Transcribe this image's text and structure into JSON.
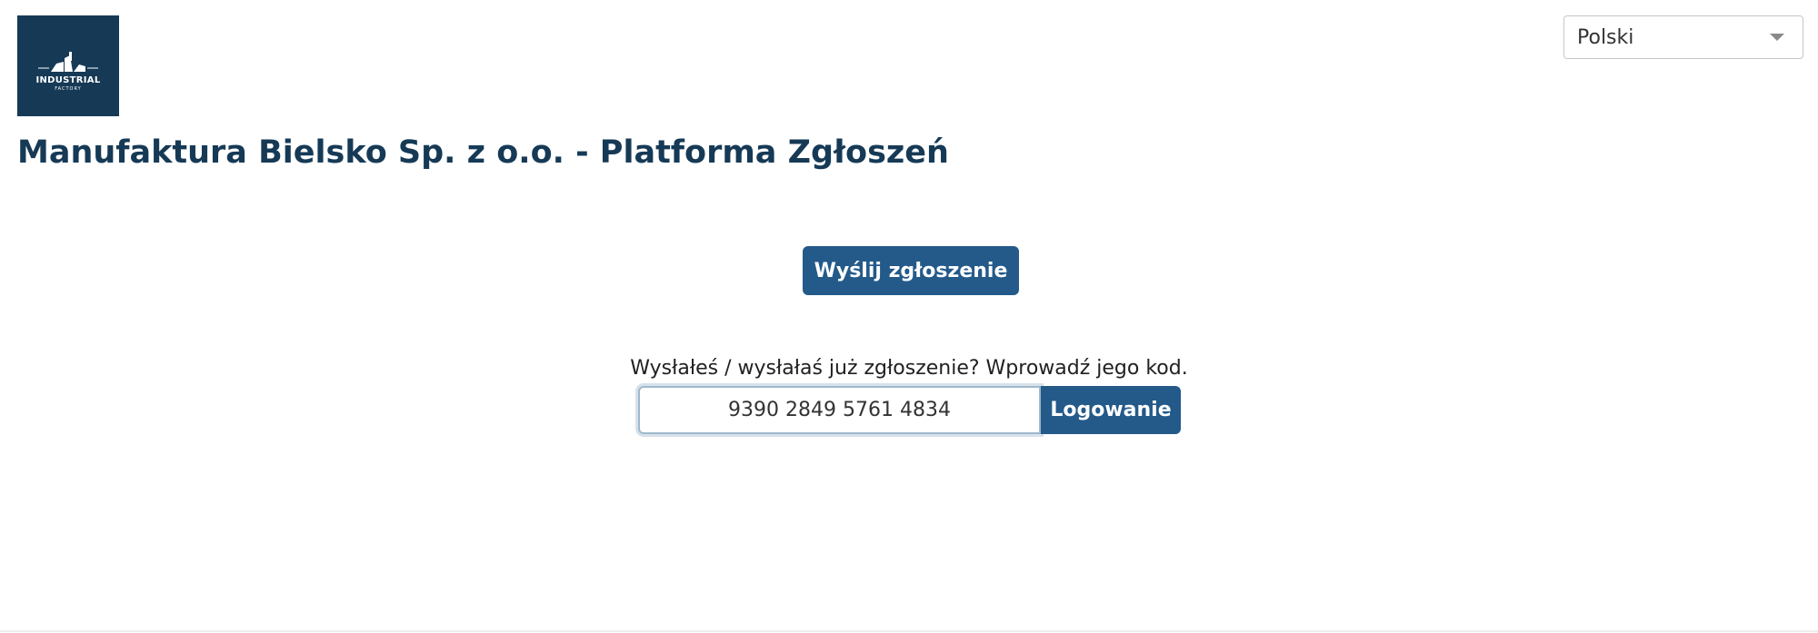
{
  "logo": {
    "text": "INDUSTRIAL",
    "subtext": "FACTORY",
    "background": "#163a56"
  },
  "language": {
    "selected": "Polski"
  },
  "header": {
    "title": "Manufaktura Bielsko Sp. z o.o. - Platforma Zgłoszeń"
  },
  "actions": {
    "submit_label": "Wyślij zgłoszenie"
  },
  "login": {
    "prompt": "Wysłałeś / wysłałaś już zgłoszenie? Wprowadź jego kod.",
    "code_value": "9390 2849 5761 4834",
    "button_label": "Logowanie"
  },
  "colors": {
    "brand": "#163a56",
    "button": "#235a8a"
  }
}
